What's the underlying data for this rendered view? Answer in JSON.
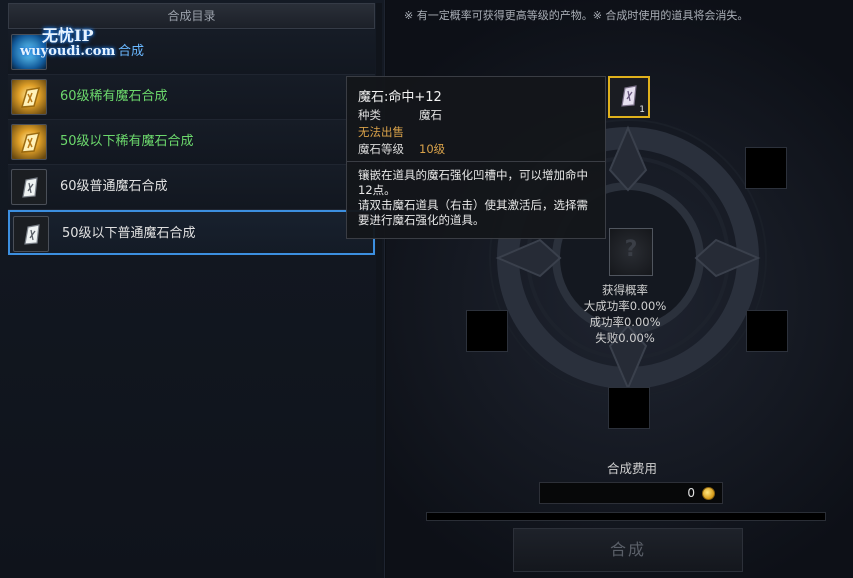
{
  "list": {
    "header": "合成目录",
    "items": [
      {
        "label": "合成",
        "color": "blue",
        "icon": "blue-magic-stone-icon"
      },
      {
        "label": "60级稀有魔石合成",
        "color": "green",
        "icon": "gold-magic-stone-icon"
      },
      {
        "label": "50级以下稀有魔石合成",
        "color": "green",
        "icon": "gold-magic-stone-icon"
      },
      {
        "label": "60级普通魔石合成",
        "color": "white",
        "icon": "white-magic-stone-icon"
      },
      {
        "label": "50级以下普通魔石合成",
        "color": "white",
        "icon": "white-magic-stone-icon",
        "selected": true
      }
    ]
  },
  "watermark": {
    "title": "无忧IP",
    "url": "wuyoudi.com"
  },
  "notice": "※ 有一定概率可获得更高等级的产物。※ 合成时使用的道具将会消失。",
  "slots": {
    "filled_qty": "1",
    "result_placeholder": "?"
  },
  "probability": {
    "title": "获得概率",
    "great_success": "大成功率0.00%",
    "success": "成功率0.00%",
    "fail": "失败0.00%"
  },
  "cost": {
    "label": "合成费用",
    "value": "0"
  },
  "craft_button": "合成",
  "tooltip": {
    "title": "魔石:命中+12",
    "type_key": "种类",
    "type_val": "魔石",
    "unsellable": "无法出售",
    "level_key": "魔石等级",
    "level_val": "10级",
    "description": "镶嵌在道具的魔石强化凹槽中，可以增加命中12点。\n请双击魔石道具（右击）使其激活后，选择需要进行魔石强化的道具。"
  },
  "colors": {
    "accent_blue": "#3c8fe0",
    "rare_green": "#6cd86c",
    "gold_border": "#e0b11c",
    "tooltip_orange": "#d9a24a",
    "level_orange": "#d9a24a"
  }
}
